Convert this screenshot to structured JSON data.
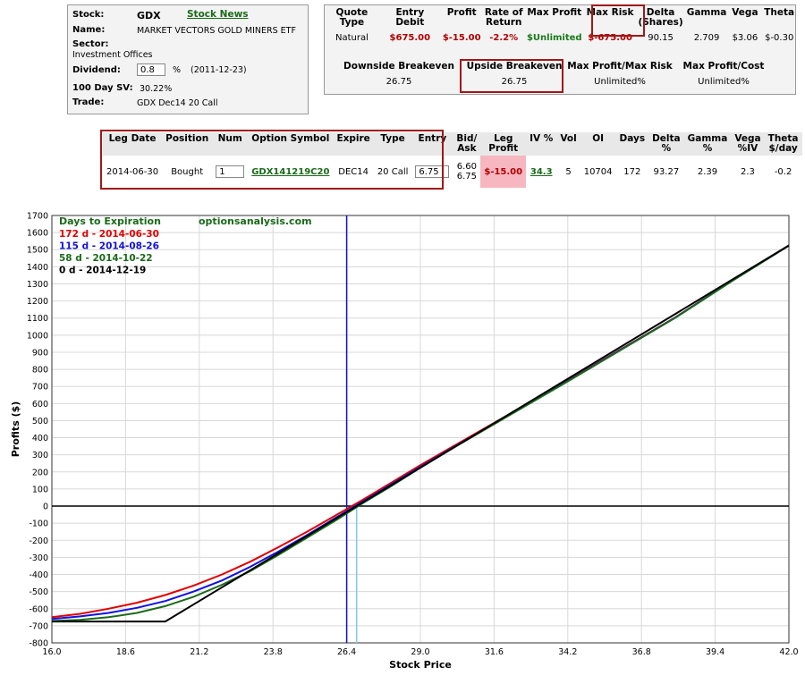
{
  "stock": {
    "stock_label": "Stock:",
    "symbol": "GDX",
    "news_link": "Stock News",
    "name_label": "Name:",
    "name": "MARKET VECTORS GOLD MINERS ETF",
    "sector_label": "Sector:",
    "sector": "Investment Offices",
    "dividend_label": "Dividend:",
    "dividend": "0.8",
    "dividend_unit": "%",
    "dividend_date": "(2011-12-23)",
    "sv_label": "100 Day SV:",
    "sv_value": "30.22%",
    "trade_label": "Trade:",
    "trade": "GDX Dec14 20 Call"
  },
  "quote": {
    "headers": [
      "Quote Type",
      "Entry Debit",
      "Profit",
      "Rate of Return",
      "Max Profit",
      "Max Risk",
      "Delta (Shares)",
      "Gamma",
      "Vega",
      "Theta"
    ],
    "values": [
      "Natural",
      "$675.00",
      "$-15.00",
      "-2.2%",
      "$Unlimited",
      "$-675.00",
      "90.15",
      "2.709",
      "$3.06",
      "$-0.30"
    ],
    "breakeven_headers": [
      "Downside Breakeven",
      "Upside Breakeven",
      "Max Profit/Max Risk",
      "Max Profit/Cost"
    ],
    "breakeven_values": [
      "26.75",
      "26.75",
      "Unlimited%",
      "Unlimited%"
    ]
  },
  "leg": {
    "headers": [
      "Leg Date",
      "Position",
      "Num",
      "Option Symbol",
      "Expire",
      "Type",
      "Entry",
      "Bid/ Ask",
      "Leg Profit",
      "IV %",
      "Vol",
      "OI",
      "Days",
      "Delta %",
      "Gamma %",
      "Vega %IV",
      "Theta $/day"
    ],
    "leg_date": "2014-06-30",
    "position": "Bought",
    "num": "1",
    "symbol": "GDX141219C20",
    "expire": "DEC14",
    "type": "20 Call",
    "entry": "6.75",
    "bid": "6.60",
    "ask": "6.75",
    "leg_profit": "$-15.00",
    "iv": "34.3",
    "vol": "5",
    "oi": "10704",
    "days": "172",
    "delta": "93.27",
    "gamma": "2.39",
    "vega": "2.3",
    "theta": "-0.2"
  },
  "colors": {
    "red": "#e00000",
    "blue": "#1010e0",
    "green": "#1a6a1a",
    "black": "#000000",
    "lightblue": "#7ec8f0",
    "highlight": "#a01818",
    "leg_profit_bg": "#f7b7c0"
  },
  "chart_data": {
    "type": "line",
    "title": "",
    "watermark": "optionsanalysis.com",
    "legend_title": "Days to Expiration",
    "xlabel": "Stock Price",
    "ylabel": "Profits ($)",
    "xlim": [
      16.0,
      42.0
    ],
    "ylim": [
      -800,
      1700
    ],
    "xticks": [
      16.0,
      18.6,
      21.2,
      23.8,
      26.4,
      29.0,
      31.6,
      34.2,
      36.8,
      39.4,
      42.0
    ],
    "yticks": [
      -800,
      -700,
      -600,
      -500,
      -400,
      -300,
      -200,
      -100,
      0,
      100,
      200,
      300,
      400,
      500,
      600,
      700,
      800,
      900,
      1000,
      1100,
      1200,
      1300,
      1400,
      1500,
      1600,
      1700
    ],
    "grid": true,
    "legend_position": "top-left",
    "current_price": 26.4,
    "breakeven": 26.75,
    "series": [
      {
        "name": "172 d - 2014-06-30",
        "color": "#e00000",
        "x": [
          16,
          17,
          18,
          19,
          20,
          21,
          22,
          23,
          24,
          25,
          26,
          27,
          28,
          29,
          30,
          32,
          34,
          36,
          38,
          40,
          42
        ],
        "y": [
          -650,
          -630,
          -600,
          -565,
          -520,
          -465,
          -400,
          -325,
          -240,
          -150,
          -55,
          40,
          140,
          240,
          335,
          525,
          715,
          910,
          1105,
          1320,
          1525
        ]
      },
      {
        "name": "115 d - 2014-08-26",
        "color": "#1010e0",
        "x": [
          16,
          17,
          18,
          19,
          20,
          21,
          22,
          23,
          24,
          25,
          26,
          27,
          28,
          29,
          30,
          32,
          34,
          36,
          38,
          40,
          42
        ],
        "y": [
          -660,
          -645,
          -625,
          -595,
          -555,
          -500,
          -435,
          -355,
          -265,
          -170,
          -70,
          30,
          130,
          230,
          328,
          520,
          712,
          908,
          1103,
          1318,
          1524
        ]
      },
      {
        "name": "58 d - 2014-10-22",
        "color": "#1a6a1a",
        "x": [
          16,
          17,
          18,
          19,
          20,
          21,
          22,
          23,
          24,
          25,
          26,
          27,
          28,
          29,
          30,
          32,
          34,
          36,
          38,
          40,
          42
        ],
        "y": [
          -672,
          -665,
          -650,
          -625,
          -585,
          -530,
          -460,
          -380,
          -285,
          -185,
          -85,
          20,
          120,
          225,
          325,
          518,
          710,
          906,
          1102,
          1317,
          1524
        ]
      },
      {
        "name": "0 d - 2014-12-19",
        "color": "#000000",
        "x": [
          16,
          20,
          42
        ],
        "y": [
          -675,
          -675,
          1525
        ]
      }
    ]
  }
}
